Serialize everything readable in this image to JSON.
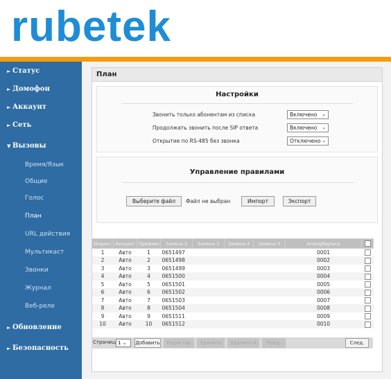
{
  "header": {
    "logo": "rubetek"
  },
  "colors": {
    "brand": "#1e8dd6",
    "accent": "#f39c12",
    "sidebar": "#2e6ca3"
  },
  "sidebar": {
    "items": [
      {
        "label": "Статус",
        "icon": "chevron-right-icon"
      },
      {
        "label": "Домофон",
        "icon": "chevron-right-icon"
      },
      {
        "label": "Аккаунт",
        "icon": "chevron-right-icon"
      },
      {
        "label": "Сеть",
        "icon": "chevron-right-icon"
      },
      {
        "label": "Вызовы",
        "icon": "chevron-down-icon"
      }
    ],
    "sub_items": [
      "Время/Язык",
      "Общие",
      "Голос",
      "План",
      "URL действия",
      "Мультикаст",
      "Звонки",
      "Журнал",
      "Веб-реле"
    ],
    "active_sub": "План",
    "bottom_items": [
      {
        "label": "Обновление",
        "icon": "chevron-right-icon"
      },
      {
        "label": "Безопасность",
        "icon": "chevron-right-icon"
      }
    ]
  },
  "page": {
    "title": "План",
    "settings": {
      "title": "Настройки",
      "rows": [
        {
          "label": "Звонить только абонентам из списка",
          "value": "Включено"
        },
        {
          "label": "Продолжать звонить после SIP ответа",
          "value": "Включено"
        },
        {
          "label": "Открытие по RS-485 без звонка",
          "value": "Отключено"
        }
      ]
    },
    "rules": {
      "title": "Управление правилами",
      "choose_file": "Выберите файл",
      "no_file": "Файл не выбран",
      "import": "Импорт",
      "export": "Экспорт"
    },
    "table": {
      "headers": [
        "Индекс",
        "Аккаунт",
        "Префикс",
        "Замена 2",
        "Замена 3",
        "Замена 4",
        "Замена 5",
        "AnalogReplace"
      ],
      "rows": [
        [
          "1",
          "Авто",
          "1",
          "0651497",
          "",
          "",
          "",
          "0001"
        ],
        [
          "2",
          "Авто",
          "2",
          "0651498",
          "",
          "",
          "",
          "0002"
        ],
        [
          "3",
          "Авто",
          "3",
          "0651499",
          "",
          "",
          "",
          "0003"
        ],
        [
          "4",
          "Авто",
          "4",
          "0651500",
          "",
          "",
          "",
          "0004"
        ],
        [
          "5",
          "Авто",
          "5",
          "0651501",
          "",
          "",
          "",
          "0005"
        ],
        [
          "6",
          "Авто",
          "6",
          "0651502",
          "",
          "",
          "",
          "0006"
        ],
        [
          "7",
          "Авто",
          "7",
          "0651503",
          "",
          "",
          "",
          "0007"
        ],
        [
          "8",
          "Авто",
          "8",
          "0651504",
          "",
          "",
          "",
          "0008"
        ],
        [
          "9",
          "Авто",
          "9",
          "0651511",
          "",
          "",
          "",
          "0009"
        ],
        [
          "10",
          "Авто",
          "10",
          "0651512",
          "",
          "",
          "",
          "0010"
        ]
      ]
    },
    "pager": {
      "label": "Страница",
      "page": "1",
      "add": "Добавить",
      "edit": "Редактир",
      "delete": "Удалить",
      "delete_all": "Удалить в",
      "prev": "Пред.",
      "next": "След."
    }
  }
}
